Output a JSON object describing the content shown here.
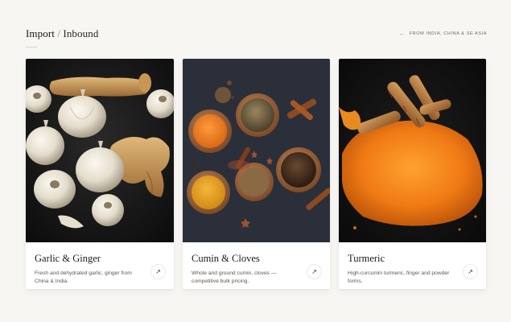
{
  "header": {
    "title_main": "Import",
    "title_sep": " / ",
    "title_sub": "Inbound",
    "origin_arrow": "←",
    "origin_text": "FROM INDIA, CHINA & SE ASIA"
  },
  "cards": [
    {
      "title": "Garlic & Ginger",
      "desc": "Fresh and dehydrated garlic, ginger from China & India.",
      "link_icon": "↗"
    },
    {
      "title": "Cumin & Cloves",
      "desc": "Whole and ground cumin, cloves — competitive bulk pricing.",
      "link_icon": "↗"
    },
    {
      "title": "Turmeric",
      "desc": "High-curcumin turmeric, finger and powder forms.",
      "link_icon": "↗"
    }
  ],
  "icons": [
    "arrow-left-icon",
    "arrow-up-right-icon"
  ]
}
